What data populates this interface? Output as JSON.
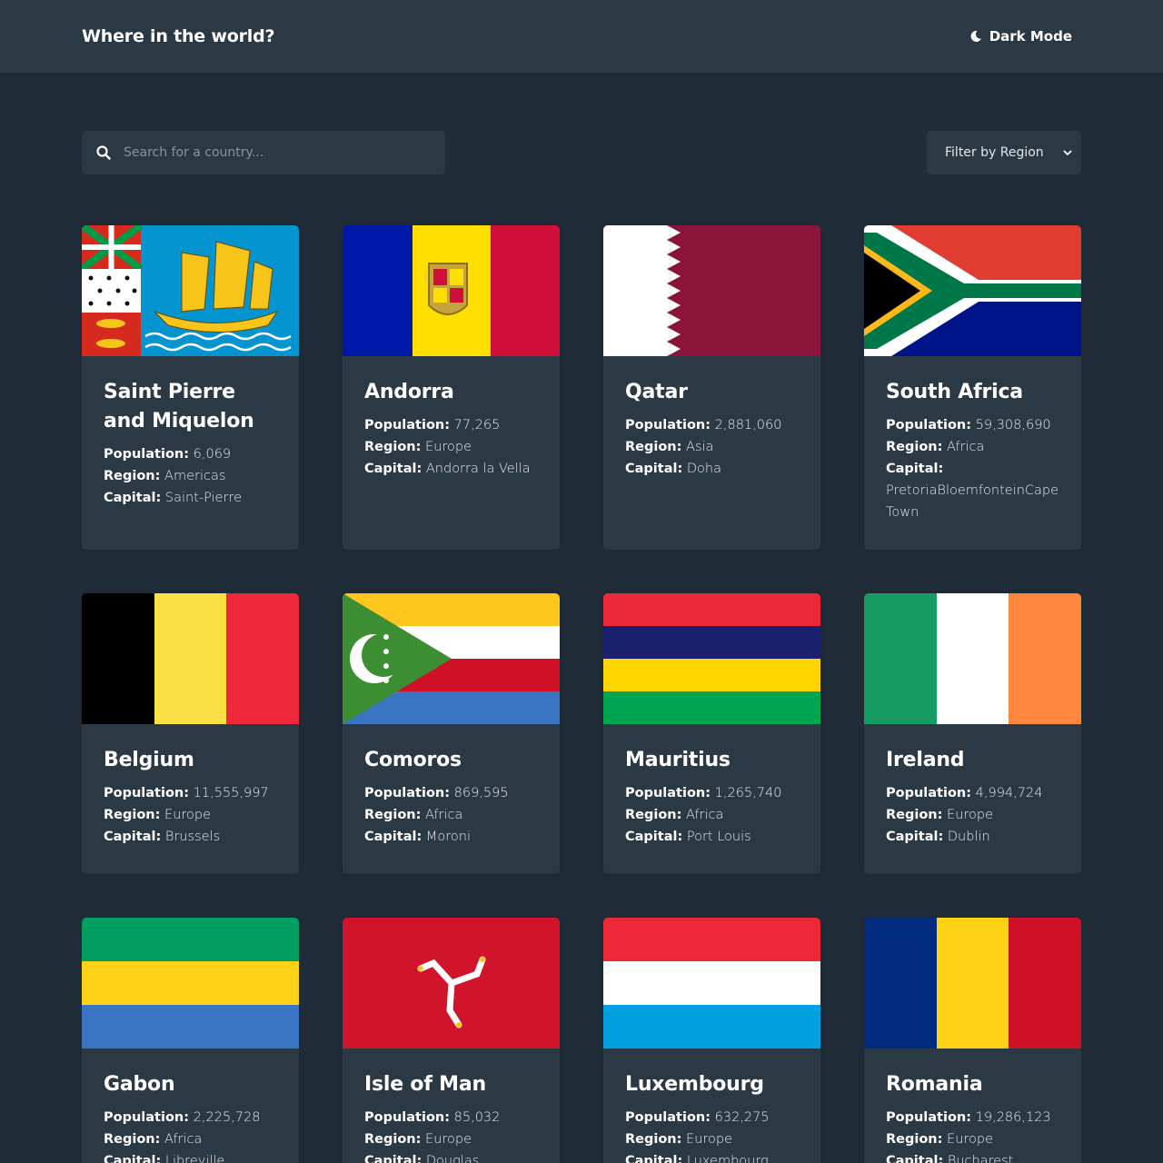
{
  "header": {
    "title": "Where in the world?",
    "mode_label": "Dark Mode"
  },
  "search": {
    "placeholder": "Search for a country...",
    "value": ""
  },
  "filter": {
    "selected": "Filter by Region"
  },
  "labels": {
    "population": "Population:",
    "region": "Region:",
    "capital": "Capital:"
  },
  "countries": [
    {
      "name": "Saint Pierre and Miquelon",
      "population": "6,069",
      "region": "Americas",
      "capital": "Saint-Pierre"
    },
    {
      "name": "Andorra",
      "population": "77,265",
      "region": "Europe",
      "capital": "Andorra la Vella"
    },
    {
      "name": "Qatar",
      "population": "2,881,060",
      "region": "Asia",
      "capital": "Doha"
    },
    {
      "name": "South Africa",
      "population": "59,308,690",
      "region": "Africa",
      "capital": "PretoriaBloemfonteinCape Town"
    },
    {
      "name": "Belgium",
      "population": "11,555,997",
      "region": "Europe",
      "capital": "Brussels"
    },
    {
      "name": "Comoros",
      "population": "869,595",
      "region": "Africa",
      "capital": "Moroni"
    },
    {
      "name": "Mauritius",
      "population": "1,265,740",
      "region": "Africa",
      "capital": "Port Louis"
    },
    {
      "name": "Ireland",
      "population": "4,994,724",
      "region": "Europe",
      "capital": "Dublin"
    },
    {
      "name": "Gabon",
      "population": "2,225,728",
      "region": "Africa",
      "capital": "Libreville"
    },
    {
      "name": "Isle of Man",
      "population": "85,032",
      "region": "Europe",
      "capital": "Douglas"
    },
    {
      "name": "Luxembourg",
      "population": "632,275",
      "region": "Europe",
      "capital": "Luxembourg"
    },
    {
      "name": "Romania",
      "population": "19,286,123",
      "region": "Europe",
      "capital": "Bucharest"
    }
  ],
  "colors": {
    "background": "#202c37",
    "surface": "#2b3945",
    "text": "#ffffff"
  },
  "icons": {
    "mode": "moon-icon",
    "search": "search-icon",
    "select": "chevron-down-icon"
  }
}
